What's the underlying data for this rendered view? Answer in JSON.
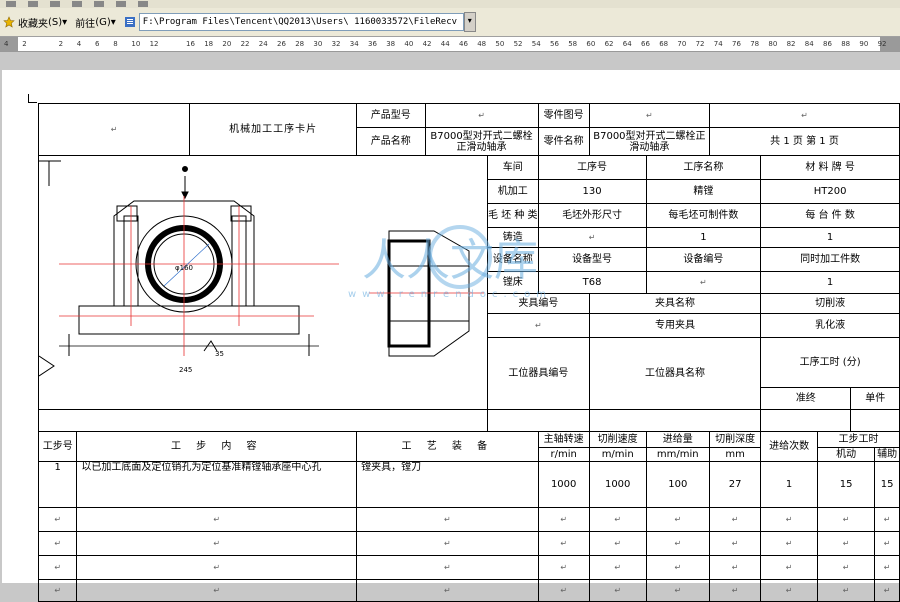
{
  "toolbar": {
    "collect_label": "收藏夹",
    "collect_shortcut": "(S)",
    "goto_label": "前往",
    "goto_shortcut": "(G)",
    "address": "F:\\Program Files\\Tencent\\QQ2013\\Users\\ 1160033572\\FileRecv"
  },
  "ruler": {
    "ticks": [
      "4",
      "2",
      "",
      "2",
      "4",
      "6",
      "8",
      "10",
      "12",
      "",
      "16",
      "18",
      "20",
      "22",
      "24",
      "26",
      "28",
      "30",
      "32",
      "34",
      "36",
      "38",
      "40",
      "42",
      "44",
      "46",
      "48",
      "50",
      "52",
      "54",
      "56",
      "58",
      "60",
      "62",
      "64",
      "66",
      "68",
      "70",
      "72",
      "74",
      "76",
      "78",
      "80",
      "82",
      "84",
      "86",
      "88",
      "90",
      "92"
    ]
  },
  "card": {
    "title": "机械加工工序卡片",
    "mark": "↵",
    "product_model_label": "产品型号",
    "product_name_label": "产品名称",
    "part_drawing_label": "零件图号",
    "part_name_label": "零件名称",
    "product_name_value": "B7000型对开式二螺栓正滑动轴承",
    "part_name_value": "B7000型对开式二螺栓正滑动轴承",
    "total_label": "共",
    "total_value": "1",
    "page_label": "页",
    "nth_label": "第",
    "nth_value": "1",
    "page_label2": "页",
    "workshop_label": "车间",
    "op_no_label": "工序号",
    "op_name_label": "工序名称",
    "material_label": "材 料 牌 号",
    "workshop_value": "机加工",
    "op_no_value": "130",
    "op_name_value": "精镗",
    "material_value": "HT200",
    "blank_type_label": "毛 坯 种 类",
    "blank_size_label": "毛坯外形尺寸",
    "per_blank_label": "每毛坯可制件数",
    "per_unit_label": "每 台 件 数",
    "blank_type_value": "铸造",
    "per_blank_value": "1",
    "per_unit_value": "1",
    "equip_name_label": "设备名称",
    "equip_model_label": "设备型号",
    "equip_no_label": "设备编号",
    "simul_label": "同时加工件数",
    "equip_name_value": "镗床",
    "equip_model_value": "T68",
    "simul_value": "1",
    "fixture_no_label": "夹具编号",
    "fixture_name_label": "夹具名称",
    "coolant_label": "切削液",
    "fixture_name_value": "专用夹具",
    "coolant_value": "乳化液",
    "station_no_label": "工位器具编号",
    "station_name_label": "工位器具名称",
    "op_time_label": "工序工时 (分)",
    "final_label": "准终",
    "unit_label": "单件",
    "step_no_label": "工步号",
    "step_content_label": "工 步 内 容",
    "process_equip_label": "工 艺 装 备",
    "spindle_label": "主轴转速",
    "spindle_unit": "r/min",
    "cut_speed_label": "切削速度",
    "cut_speed_unit": "m/min",
    "feed_label": "进给量",
    "feed_unit": "mm/min",
    "depth_label": "切削深度",
    "depth_unit": "mm",
    "passes_label": "进给次数",
    "step_time_label": "工步工时",
    "machine_label": "机动",
    "aux_label": "辅助",
    "step1": {
      "no": "1",
      "content": "以已加工底面及定位销孔为定位基准精镗轴承座中心孔",
      "equip": "镗夹具，镗刀",
      "spindle": "1000",
      "cut_speed": "1000",
      "feed": "100",
      "depth": "27",
      "passes": "1",
      "machine": "15",
      "aux": "15"
    },
    "drawing": {
      "dim_diam": "φ160",
      "dim_width": "245",
      "dim_small": "35"
    }
  },
  "watermark": {
    "text": "人人文库",
    "url": "www.renrendoc.com"
  }
}
